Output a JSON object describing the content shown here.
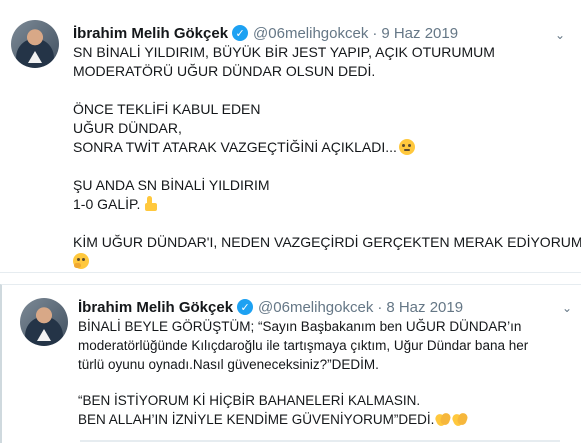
{
  "tweets": [
    {
      "name": "İbrahim Melih Gökçek",
      "handle": "@06melihgokcek",
      "separator": "·",
      "date": "9 Haz 2019",
      "lines": [
        "SN BİNALİ YILDIRIM, BÜYÜK BİR JEST YAPIP, AÇIK OTURUMUM",
        "MODERATÖRÜ UĞUR DÜNDAR OLSUN DEDİ.",
        "ÖNCE TEKLİFİ KABUL EDEN",
        "UĞUR DÜNDAR,",
        "SONRA TWİT ATARAK VAZGEÇTİĞİNİ AÇIKLADI...",
        "ŞU ANDA SN BİNALİ YILDIRIM",
        "1-0 GALİP.",
        "KİM UĞUR DÜNDAR'I, NEDEN VAZGEÇİRDİ GERÇEKTEN MERAK EDİYORUM."
      ],
      "icons": [
        "verified-badge",
        "face-with-rolling-eyes",
        "thumbs-up",
        "thinking-face",
        "chevron-down"
      ]
    },
    {
      "name": "İbrahim Melih Gökçek",
      "handle": "@06melihgokcek",
      "separator": "·",
      "date": "8 Haz 2019",
      "lines": [
        "BİNALİ BEYLE GÖRÜŞTÜM;  “Sayın Başbakanım ben UĞUR DÜNDAR’ın",
        "moderatörlüğünde Kılıçdaroğlu ile tartışmaya çıktım, Uğur Dündar bana her",
        "türlü oyunu oynadı.Nasıl güveneceksiniz?”DEDİM.",
        "“BEN İSTİYORUM Kİ HİÇBİR BAHANELERİ KALMASIN.",
        "BEN ALLAH’IN İZNİYLE KENDİME GÜVENİYORUM”DEDİ."
      ],
      "icons": [
        "verified-badge",
        "clapping-hands",
        "clapping-hands",
        "chevron-down"
      ]
    }
  ],
  "colors": {
    "text": "#14171a",
    "muted": "#657786",
    "verified": "#1da1f2",
    "border": "#e6ecf0"
  }
}
